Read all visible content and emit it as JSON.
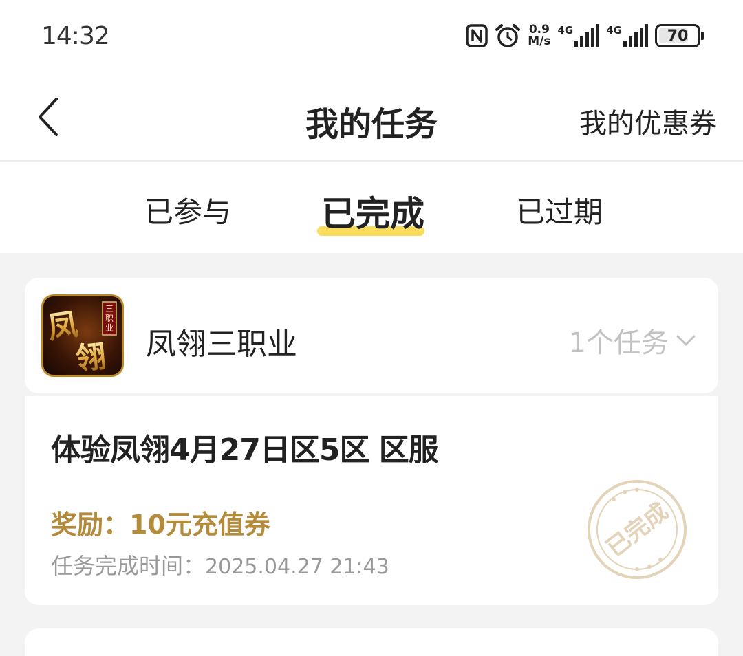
{
  "status_bar": {
    "time": "14:32",
    "net_speed_value": "0.9",
    "net_speed_unit": "M/s",
    "sim1_label": "4G",
    "sim2_label": "4G",
    "battery_level": "70",
    "icons": [
      "nfc-icon",
      "alarm-icon",
      "signal-icon",
      "signal-icon",
      "battery-icon"
    ]
  },
  "nav": {
    "back_icon": "chevron-left-icon",
    "title": "我的任务",
    "right_link": "我的优惠券"
  },
  "tabs": [
    {
      "label": "已参与",
      "active": false
    },
    {
      "label": "已完成",
      "active": true
    },
    {
      "label": "已过期",
      "active": false
    }
  ],
  "game": {
    "name": "凤翎三职业",
    "task_count": "1个任务",
    "toggle_icon": "chevron-down-icon",
    "logo_text_main": "凤翎",
    "logo_text_badge": "三职业"
  },
  "task": {
    "title": "体验凤翎4月27日区5区 区服",
    "reward_label": "奖励：",
    "reward_value": "10元充值券",
    "finish_time_label": "任务完成时间：",
    "finish_time_value": "2025.04.27 21:43",
    "stamp_text": "已完成"
  },
  "colors": {
    "accent_yellow": "#f9dc5c",
    "reward_gold": "#b38b3a",
    "stamp_beige": "#e3d3b8",
    "page_bg": "#f3f3f3"
  }
}
